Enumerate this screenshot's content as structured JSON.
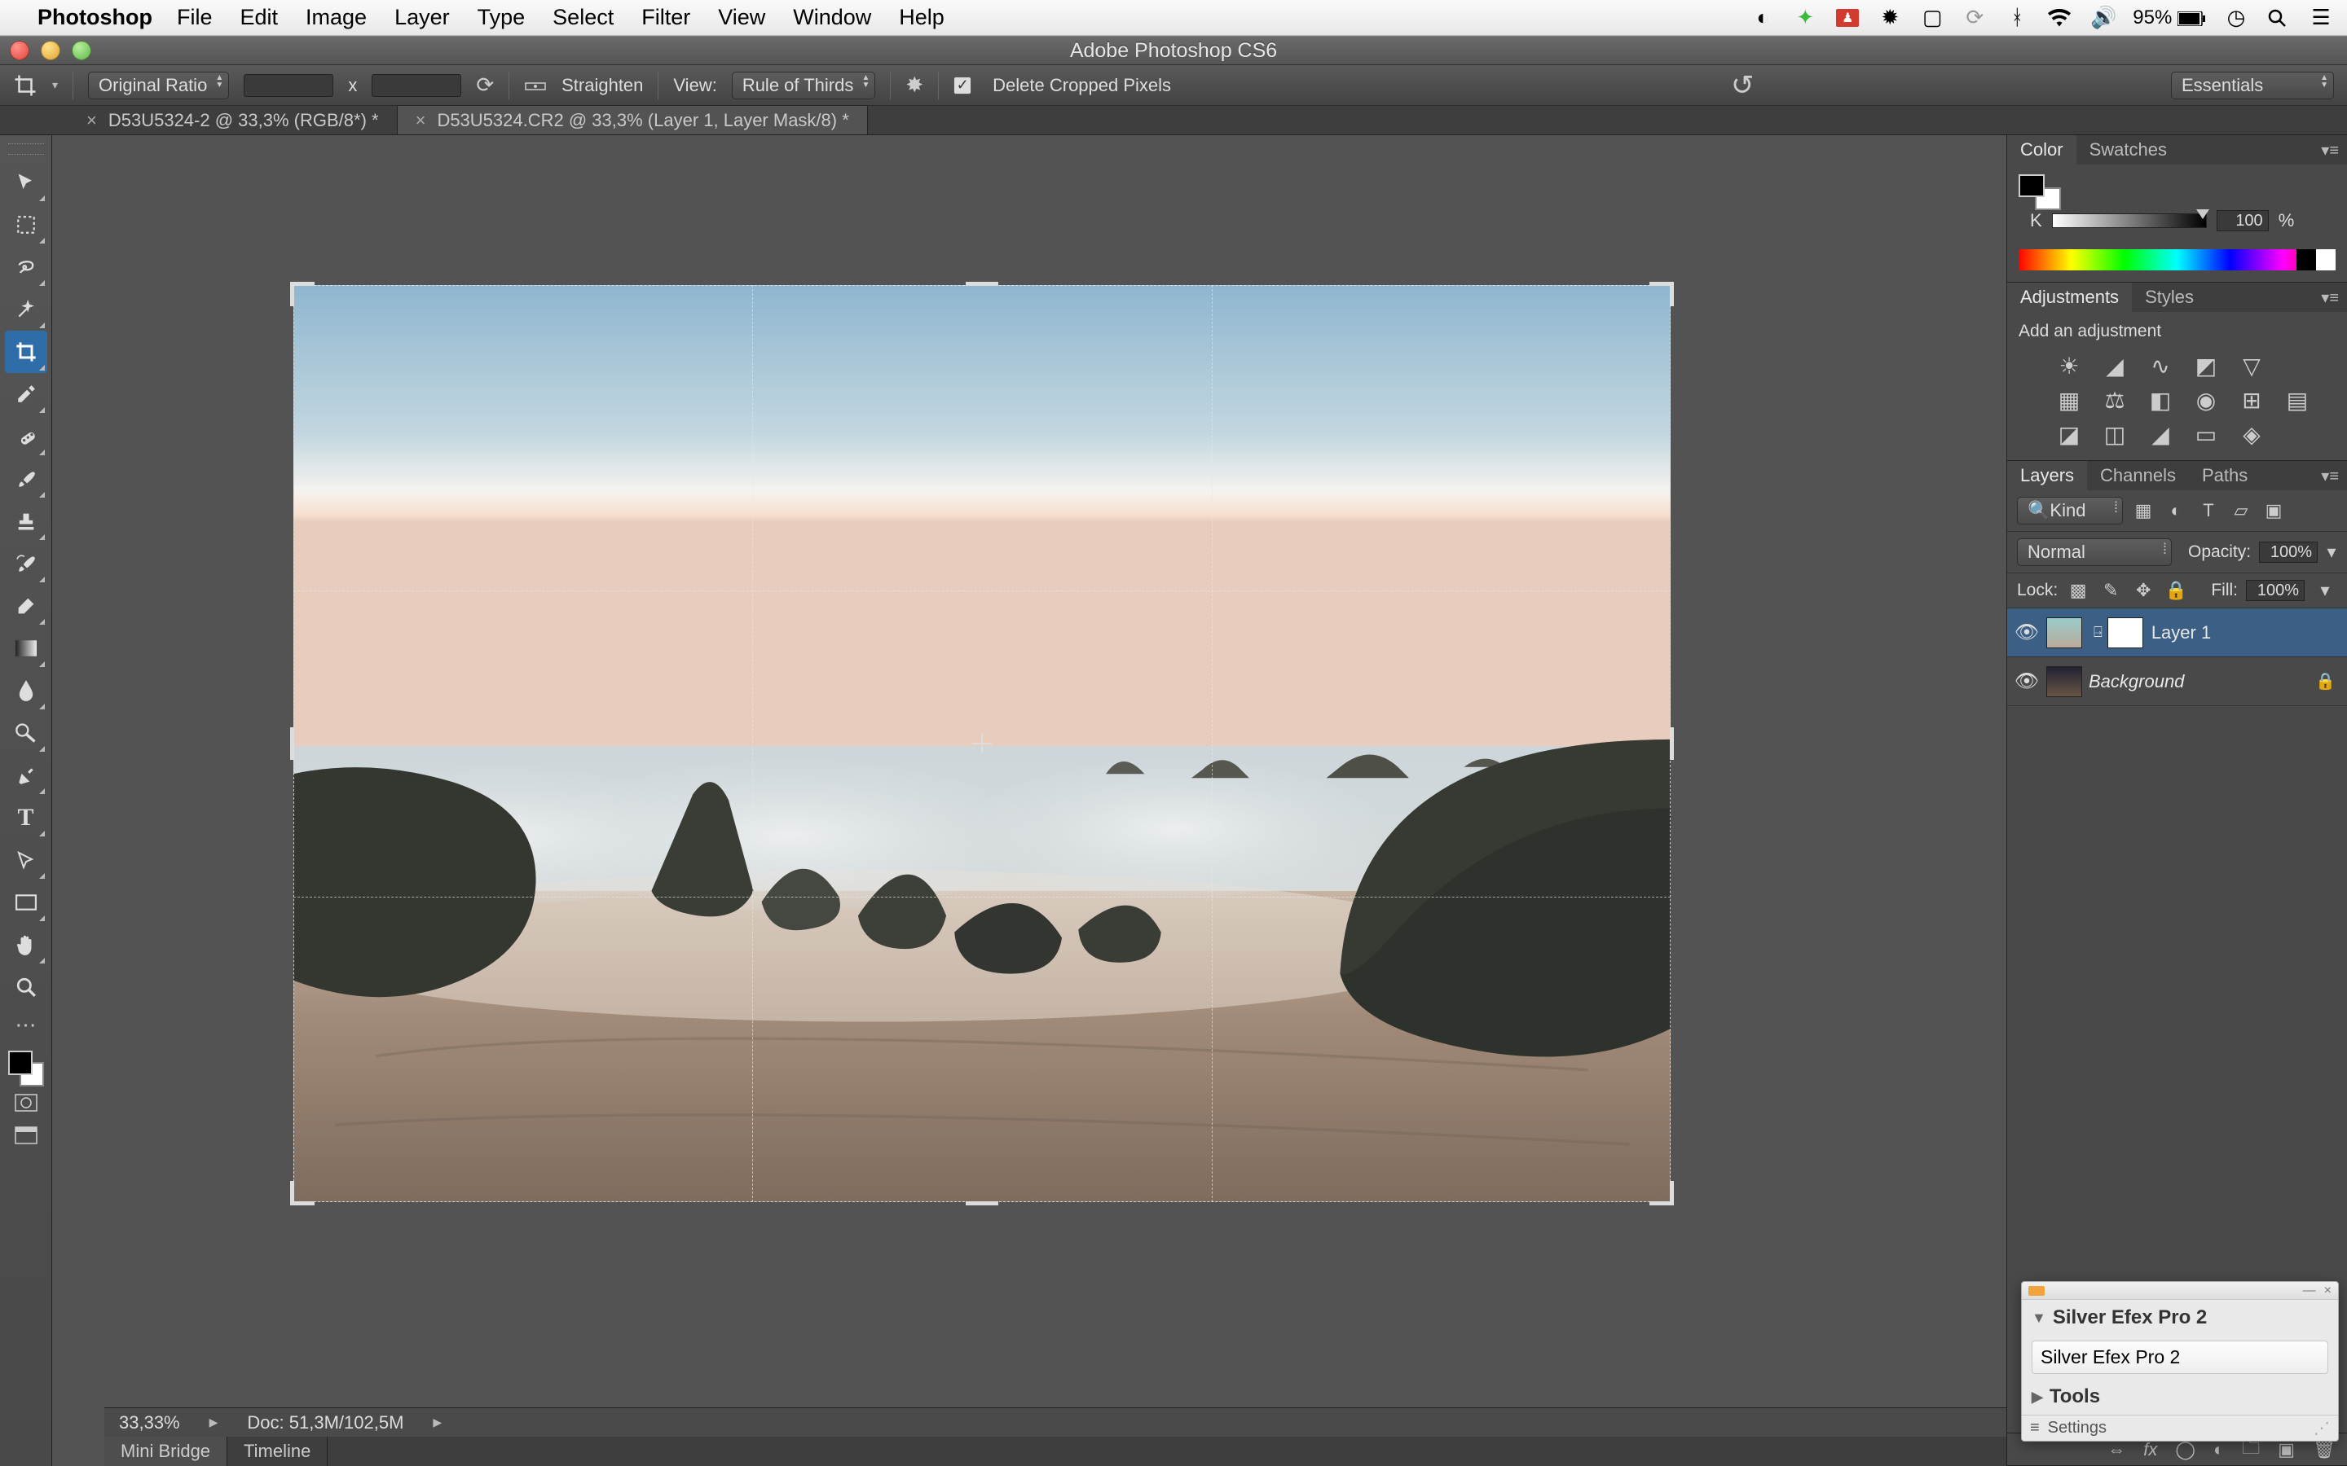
{
  "mac_menu": {
    "app": "Photoshop",
    "items": [
      "File",
      "Edit",
      "Image",
      "Layer",
      "Type",
      "Select",
      "Filter",
      "View",
      "Window",
      "Help"
    ],
    "battery_pct": "95%"
  },
  "window": {
    "title": "Adobe Photoshop CS6"
  },
  "options": {
    "ratio": "Original Ratio",
    "width": "",
    "height": "",
    "x_label": "x",
    "straighten": "Straighten",
    "view_label": "View:",
    "view_value": "Rule of Thirds",
    "delete_cropped": "Delete Cropped Pixels",
    "workspace": "Essentials"
  },
  "doc_tabs": [
    {
      "label": "D53U5324-2 @ 33,3% (RGB/8*) *",
      "active": false
    },
    {
      "label": "D53U5324.CR2 @ 33,3% (Layer 1, Layer Mask/8) *",
      "active": true
    }
  ],
  "tools": [
    "move",
    "marquee",
    "lasso",
    "wand",
    "crop",
    "eyedropper",
    "healing",
    "brush",
    "stamp",
    "history-brush",
    "eraser",
    "gradient",
    "blur",
    "dodge",
    "pen",
    "type",
    "path",
    "shape",
    "hand",
    "zoom"
  ],
  "status": {
    "zoom": "33,33%",
    "doc": "Doc: 51,3M/102,5M"
  },
  "bottom_tabs": [
    "Mini Bridge",
    "Timeline"
  ],
  "color_panel": {
    "tabs": [
      "Color",
      "Swatches"
    ],
    "channel": "K",
    "value": "100",
    "pct": "%"
  },
  "adjust_panel": {
    "tabs": [
      "Adjustments",
      "Styles"
    ],
    "hint": "Add an adjustment"
  },
  "layers_panel": {
    "tabs": [
      "Layers",
      "Channels",
      "Paths"
    ],
    "kind": "Kind",
    "blend": "Normal",
    "opacity_label": "Opacity:",
    "opacity": "100%",
    "lock_label": "Lock:",
    "fill_label": "Fill:",
    "fill": "100%",
    "layers": [
      {
        "name": "Layer 1",
        "selected": true,
        "mask": true,
        "locked": false
      },
      {
        "name": "Background",
        "selected": false,
        "mask": false,
        "locked": true
      }
    ]
  },
  "plugin": {
    "title": "Silver Efex Pro 2",
    "button": "Silver Efex Pro 2",
    "tools": "Tools",
    "settings": "Settings"
  }
}
